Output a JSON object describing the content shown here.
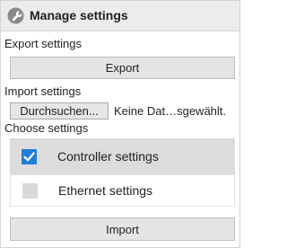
{
  "header": {
    "title": "Manage settings",
    "icon": "wrench-icon"
  },
  "export": {
    "section_label": "Export settings",
    "button_label": "Export"
  },
  "import": {
    "section_label": "Import settings",
    "browse_label": "Durchsuchen...",
    "file_status": "Keine Dat…sgewählt.",
    "button_label": "Import"
  },
  "choose": {
    "section_label": "Choose settings",
    "options": [
      {
        "label": "Controller settings",
        "checked": true
      },
      {
        "label": "Ethernet settings",
        "checked": false
      }
    ]
  },
  "colors": {
    "accent": "#1e7fd8",
    "header_bg": "#ececec",
    "selected_row": "#dcdcdc"
  }
}
